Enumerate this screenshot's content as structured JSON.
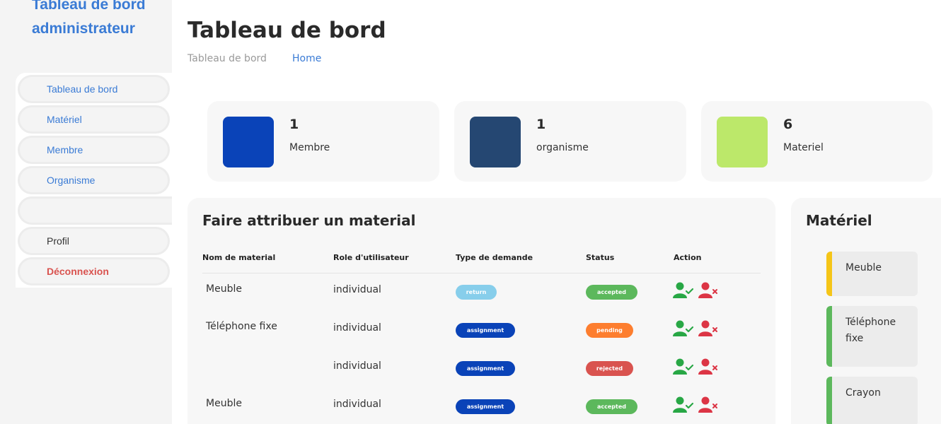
{
  "brand": {
    "title": "Tableau de bord administrateur"
  },
  "sidebar": {
    "items": [
      {
        "label": "Tableau de bord"
      },
      {
        "label": "Matériel"
      },
      {
        "label": "Membre"
      },
      {
        "label": "Organisme"
      }
    ],
    "profile_label": "Profil",
    "logout_label": "Déconnexion"
  },
  "header": {
    "title": "Tableau de bord",
    "breadcrumb": [
      "Tableau de bord",
      "Home"
    ]
  },
  "stats": [
    {
      "count": "1",
      "label": "Membre",
      "color": "#0a43b8"
    },
    {
      "count": "1",
      "label": "organisme",
      "color": "#254772"
    },
    {
      "count": "6",
      "label": "Materiel",
      "color": "#bce86a"
    }
  ],
  "assign_table": {
    "title": "Faire attribuer un material",
    "columns": [
      "Nom de material",
      "Role d'utilisateur",
      "Type de demande",
      "Status",
      "Action"
    ],
    "rows": [
      {
        "name": "Meuble",
        "role": "individual",
        "type": "return",
        "status": "accepted"
      },
      {
        "name": "Téléphone fixe",
        "role": "individual",
        "type": "assignment",
        "status": "pending"
      },
      {
        "name": "",
        "role": "individual",
        "type": "assignment",
        "status": "rejected"
      },
      {
        "name": "Meuble",
        "role": "individual",
        "type": "assignment",
        "status": "accepted"
      }
    ]
  },
  "materiel_panel": {
    "title": "Matériel",
    "items": [
      {
        "label": "Meuble",
        "color": "#f5c518"
      },
      {
        "label": "Téléphone fixe",
        "color": "#5cb85c"
      },
      {
        "label": "Crayon",
        "color": "#5cb85c"
      }
    ]
  },
  "colors": {
    "accent": "#3a7bd5",
    "logout": "#d9534f",
    "return": "#87ceeb",
    "assignment": "#0a43b8",
    "accepted": "#5cb85c",
    "pending": "#fd7e2f",
    "rejected": "#d9534f",
    "approve_icon": "#28a745",
    "reject_icon": "#dc3545"
  },
  "icons": {
    "approve": "user-check-icon",
    "reject": "user-remove-icon"
  }
}
